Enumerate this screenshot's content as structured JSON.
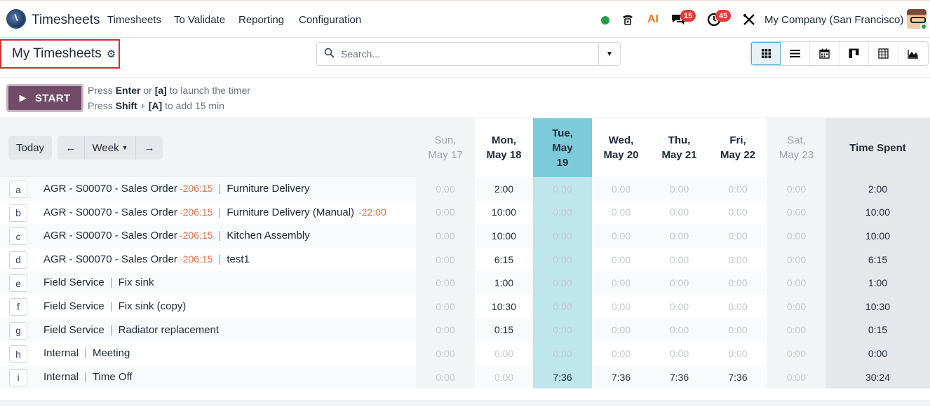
{
  "navbar": {
    "app_name": "Timesheets",
    "menu": [
      "Timesheets",
      "To Validate",
      "Reporting",
      "Configuration"
    ],
    "badges": {
      "messages": "15",
      "activities": "45"
    },
    "company": "My Company (San Francisco)",
    "ai_label": "AI"
  },
  "control": {
    "title": "My Timesheets",
    "search_placeholder": "Search..."
  },
  "timer": {
    "start_label": "START",
    "hint1": {
      "a": "Press ",
      "b": "Enter",
      "c": " or ",
      "d": "[a]",
      "e": " to launch the timer"
    },
    "hint2": {
      "a": "Press ",
      "b": "Shift",
      "c": " + ",
      "d": "[A]",
      "e": " to add 15 min"
    }
  },
  "grid": {
    "today_label": "Today",
    "prev_label": "←",
    "range_label": "Week",
    "next_label": "→",
    "days": [
      {
        "dow": "Sun,",
        "date": "May 17",
        "kind": "weekend"
      },
      {
        "dow": "Mon,",
        "date": "May 18",
        "kind": "weekday"
      },
      {
        "dow": "Tue,",
        "date": "May 19",
        "kind": "today"
      },
      {
        "dow": "Wed,",
        "date": "May 20",
        "kind": "weekday"
      },
      {
        "dow": "Thu,",
        "date": "May 21",
        "kind": "weekday"
      },
      {
        "dow": "Fri,",
        "date": "May 22",
        "kind": "weekday"
      },
      {
        "dow": "Sat,",
        "date": "May 23",
        "kind": "weekend"
      }
    ],
    "total_header": "Time Spent",
    "rows": [
      {
        "key": "a",
        "project": "AGR - S00070 - Sales Order",
        "project_extra": "-206:15",
        "task": "Furniture Delivery",
        "task_extra": "",
        "hours": [
          "0:00",
          "2:00",
          "0:00",
          "0:00",
          "0:00",
          "0:00",
          "0:00"
        ],
        "total": "2:00"
      },
      {
        "key": "b",
        "project": "AGR - S00070 - Sales Order",
        "project_extra": "-206:15",
        "task": "Furniture Delivery (Manual)",
        "task_extra": "-22:00",
        "hours": [
          "0:00",
          "10:00",
          "0:00",
          "0:00",
          "0:00",
          "0:00",
          "0:00"
        ],
        "total": "10:00"
      },
      {
        "key": "c",
        "project": "AGR - S00070 - Sales Order",
        "project_extra": "-206:15",
        "task": "Kitchen Assembly",
        "task_extra": "",
        "hours": [
          "0:00",
          "10:00",
          "0:00",
          "0:00",
          "0:00",
          "0:00",
          "0:00"
        ],
        "total": "10:00"
      },
      {
        "key": "d",
        "project": "AGR - S00070 - Sales Order",
        "project_extra": "-206:15",
        "task": "test1",
        "task_extra": "",
        "hours": [
          "0:00",
          "6:15",
          "0:00",
          "0:00",
          "0:00",
          "0:00",
          "0:00"
        ],
        "total": "6:15"
      },
      {
        "key": "e",
        "project": "Field Service",
        "project_extra": "",
        "task": "Fix sink",
        "task_extra": "",
        "hours": [
          "0:00",
          "1:00",
          "0:00",
          "0:00",
          "0:00",
          "0:00",
          "0:00"
        ],
        "total": "1:00"
      },
      {
        "key": "f",
        "project": "Field Service",
        "project_extra": "",
        "task": "Fix sink (copy)",
        "task_extra": "",
        "hours": [
          "0:00",
          "10:30",
          "0:00",
          "0:00",
          "0:00",
          "0:00",
          "0:00"
        ],
        "total": "10:30"
      },
      {
        "key": "g",
        "project": "Field Service",
        "project_extra": "",
        "task": "Radiator replacement",
        "task_extra": "",
        "hours": [
          "0:00",
          "0:15",
          "0:00",
          "0:00",
          "0:00",
          "0:00",
          "0:00"
        ],
        "total": "0:15"
      },
      {
        "key": "h",
        "project": "Internal",
        "project_extra": "",
        "task": "Meeting",
        "task_extra": "",
        "hours": [
          "0:00",
          "0:00",
          "0:00",
          "0:00",
          "0:00",
          "0:00",
          "0:00"
        ],
        "total": "0:00"
      },
      {
        "key": "i",
        "project": "Internal",
        "project_extra": "",
        "task": "Time Off",
        "task_extra": "",
        "hours": [
          "0:00",
          "0:00",
          "7:36",
          "7:36",
          "7:36",
          "7:36",
          "0:00"
        ],
        "total": "30:24"
      }
    ]
  }
}
